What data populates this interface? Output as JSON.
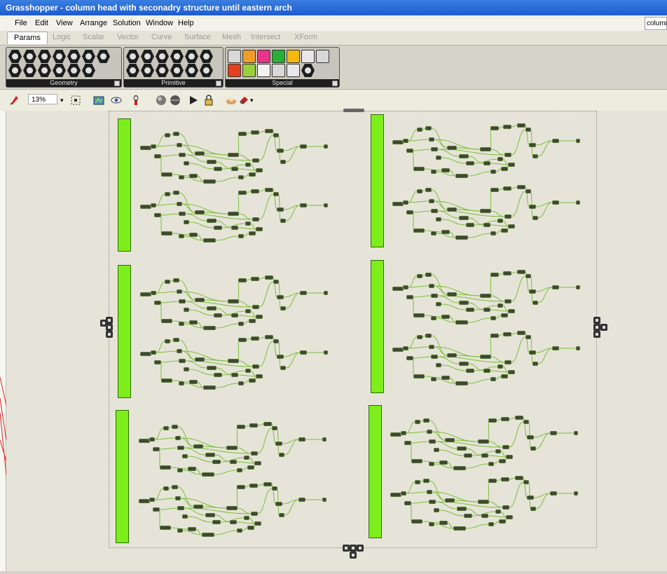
{
  "window": {
    "title": "Grasshopper - column head with seconadry structure until eastern arch"
  },
  "menu": {
    "items": [
      "File",
      "Edit",
      "View",
      "Arrange",
      "Solution",
      "Window",
      "Help"
    ],
    "right_text": "column"
  },
  "tabs": [
    "Params",
    "Logic",
    "Scalar",
    "Vector",
    "Curve",
    "Surface",
    "Mesh",
    "Intersect",
    "XForm"
  ],
  "active_tab": "Params",
  "ribbon": {
    "panels": [
      {
        "label": "Geometry"
      },
      {
        "label": "Primitive"
      },
      {
        "label": "Special"
      }
    ]
  },
  "toolbar": {
    "zoom": "13%"
  },
  "colors": {
    "group": "#7dee1b",
    "wire": "#7bbd3c",
    "node": "#3d4a2e"
  }
}
